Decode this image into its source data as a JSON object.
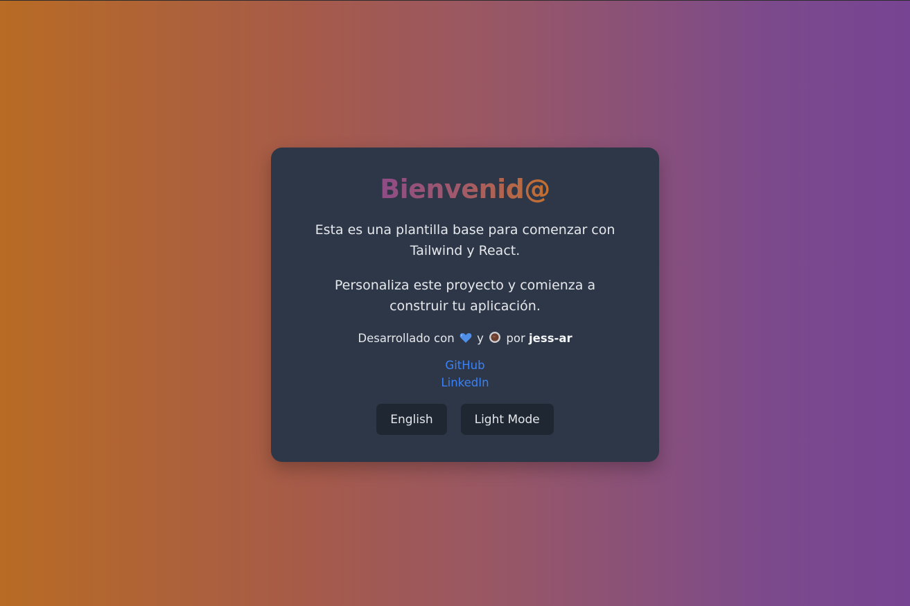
{
  "card": {
    "title": "Bienvenid@",
    "paragraph_1": "Esta es una plantilla base para comenzar con Tailwind y React.",
    "paragraph_2": "Personaliza este proyecto y comienza a construir tu aplicación.",
    "credits": {
      "prefix": "Desarrollado con",
      "heart_icon": "blue-heart-icon",
      "connector": "y",
      "coffee_icon": "coffee-icon",
      "by": "por",
      "author": "jess-ar"
    },
    "links": {
      "github": "GitHub",
      "linkedin": "LinkedIn"
    },
    "buttons": {
      "language": "English",
      "theme": "Light Mode"
    }
  },
  "colors": {
    "card_background": "#2d3748",
    "link": "#3b82f6",
    "button_background": "#1f2733",
    "gradient_start": "#b86b24",
    "gradient_end": "#774493"
  }
}
